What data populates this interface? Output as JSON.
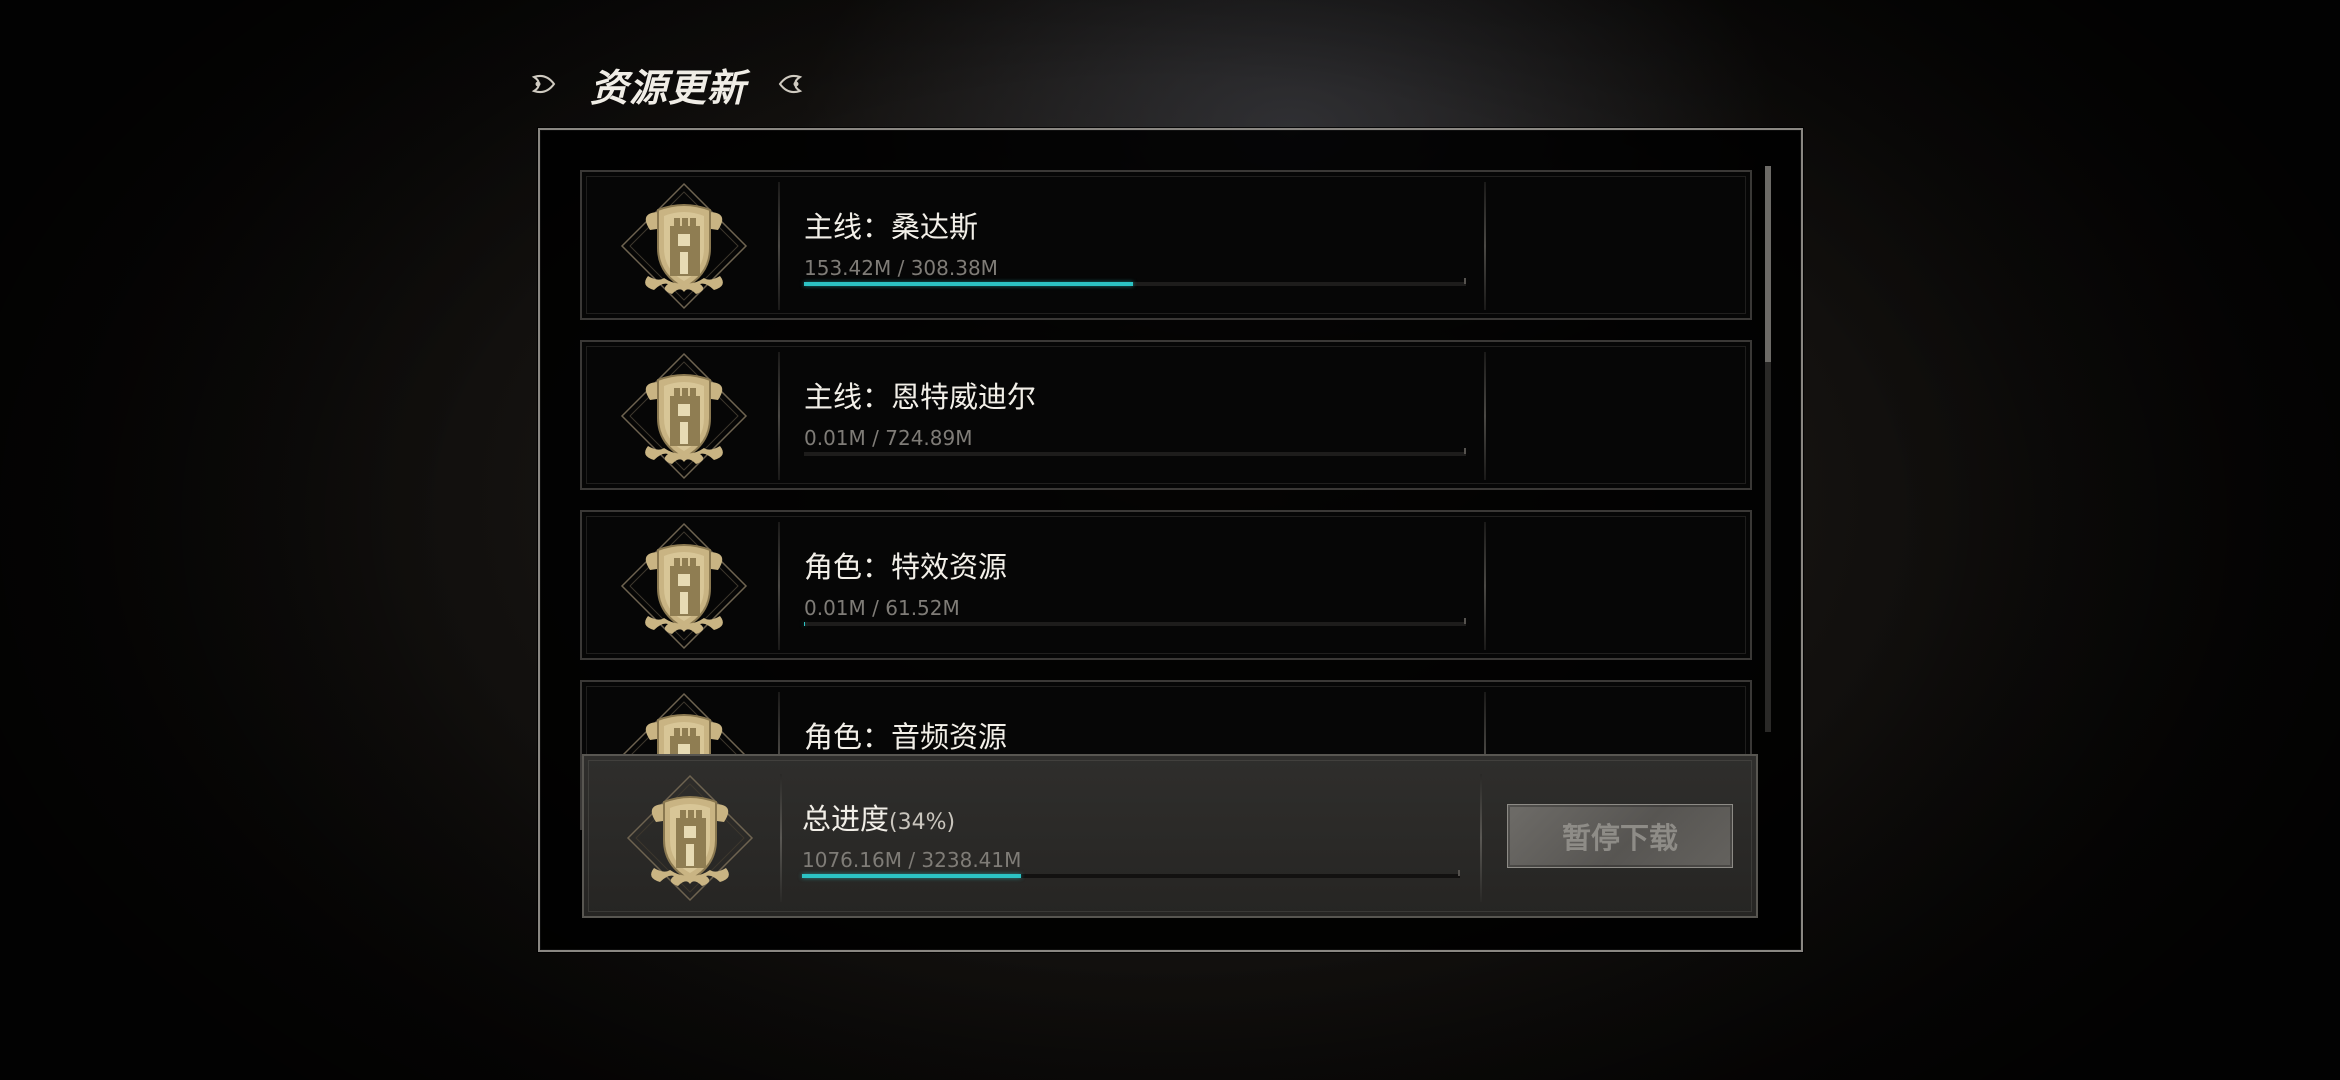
{
  "header": {
    "title": "资源更新",
    "left_ornament_icon": "leaf-ornament-left-icon",
    "right_ornament_icon": "leaf-ornament-right-icon"
  },
  "colors": {
    "accent_progress": "#2cc3c4",
    "emblem_gold": "#c9b483",
    "button_bg": "#5f5d59"
  },
  "downloads": [
    {
      "name": "主线：桑达斯",
      "size": "153.42M / 308.38M",
      "progress": 0.4975,
      "icon": "castle-shield-emblem-icon"
    },
    {
      "name": "主线：恩特威迪尔",
      "size": "0.01M / 724.89M",
      "progress": 0.0,
      "icon": "castle-shield-emblem-icon"
    },
    {
      "name": "角色：特效资源",
      "size": "0.01M / 61.52M",
      "progress": 0.0002,
      "icon": "castle-shield-emblem-icon"
    },
    {
      "name": "角色：音频资源",
      "size": "",
      "progress": 0.0,
      "icon": "castle-shield-emblem-icon"
    }
  ],
  "total": {
    "label": "总进度",
    "percent": "(34%)",
    "size": "1076.16M / 3238.41M",
    "progress": 0.3323,
    "icon": "castle-shield-emblem-icon"
  },
  "actions": {
    "pause_label": "暂停下载"
  }
}
